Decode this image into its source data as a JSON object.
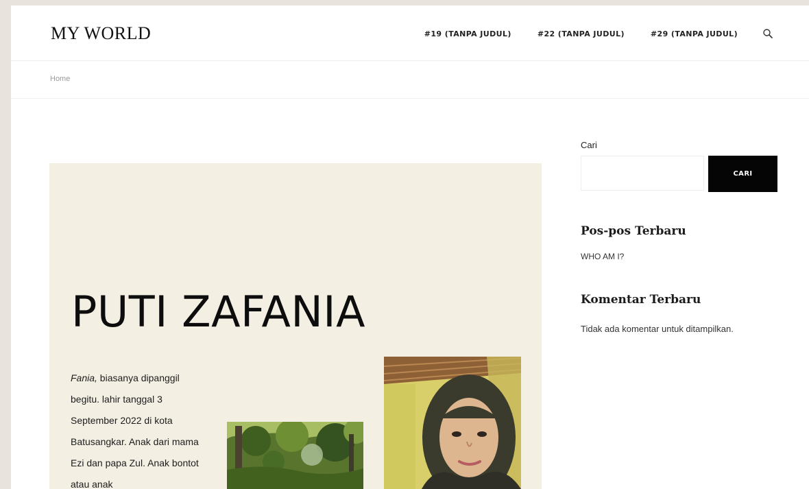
{
  "header": {
    "site_title": "MY WORLD",
    "nav": [
      "#19 (TANPA JUDUL)",
      "#22 (TANPA JUDUL)",
      "#29 (TANPA JUDUL)"
    ]
  },
  "breadcrumb": {
    "home": "Home"
  },
  "hero": {
    "title": "PUTI ZAFANIA",
    "intro_name": "Fania,",
    "intro_text": " biasanya dipanggil begitu. lahir tanggal 3 September 2022 di kota Batusangkar. Anak dari mama Ezi dan papa Zul. Anak bontot atau anak"
  },
  "sidebar": {
    "search_label": "Cari",
    "search_placeholder": "",
    "search_button": "CARI",
    "recent_posts_title": "Pos-pos Terbaru",
    "recent_posts": [
      "WHO AM I?"
    ],
    "recent_comments_title": "Komentar Terbaru",
    "no_comments": "Tidak ada komentar untuk ditampilkan."
  },
  "colors": {
    "hero_background": "#f3efe3",
    "button_background": "#050505",
    "page_background": "#ffffff"
  },
  "icons": {
    "search": "search-icon"
  }
}
